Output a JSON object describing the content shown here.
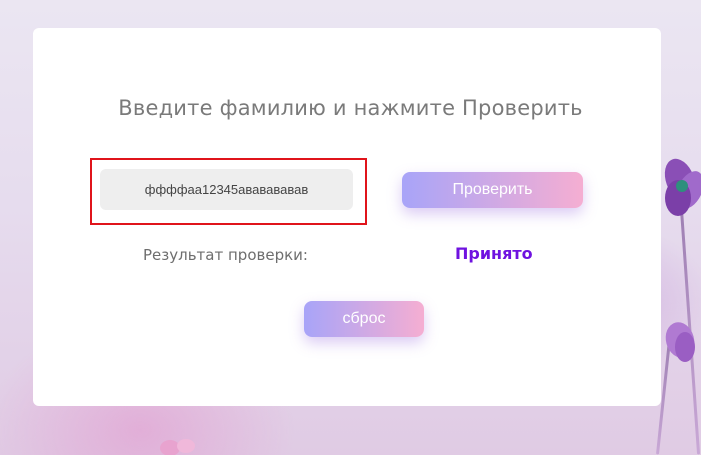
{
  "form": {
    "heading": "Введите фамилию и нажмите Проверить",
    "surname_value": "ффффаа12345ававававав",
    "check_button_label": "Проверить",
    "result_label": "Результат проверки:",
    "result_value": "Принято",
    "reset_button_label": "сброс"
  },
  "colors": {
    "result_accent": "#6f12e0",
    "highlight_border": "#e0141b",
    "button_gradient_start": "#a8a4f8",
    "button_gradient_end": "#f5aed2"
  },
  "icons": [
    "flower-decoration"
  ]
}
